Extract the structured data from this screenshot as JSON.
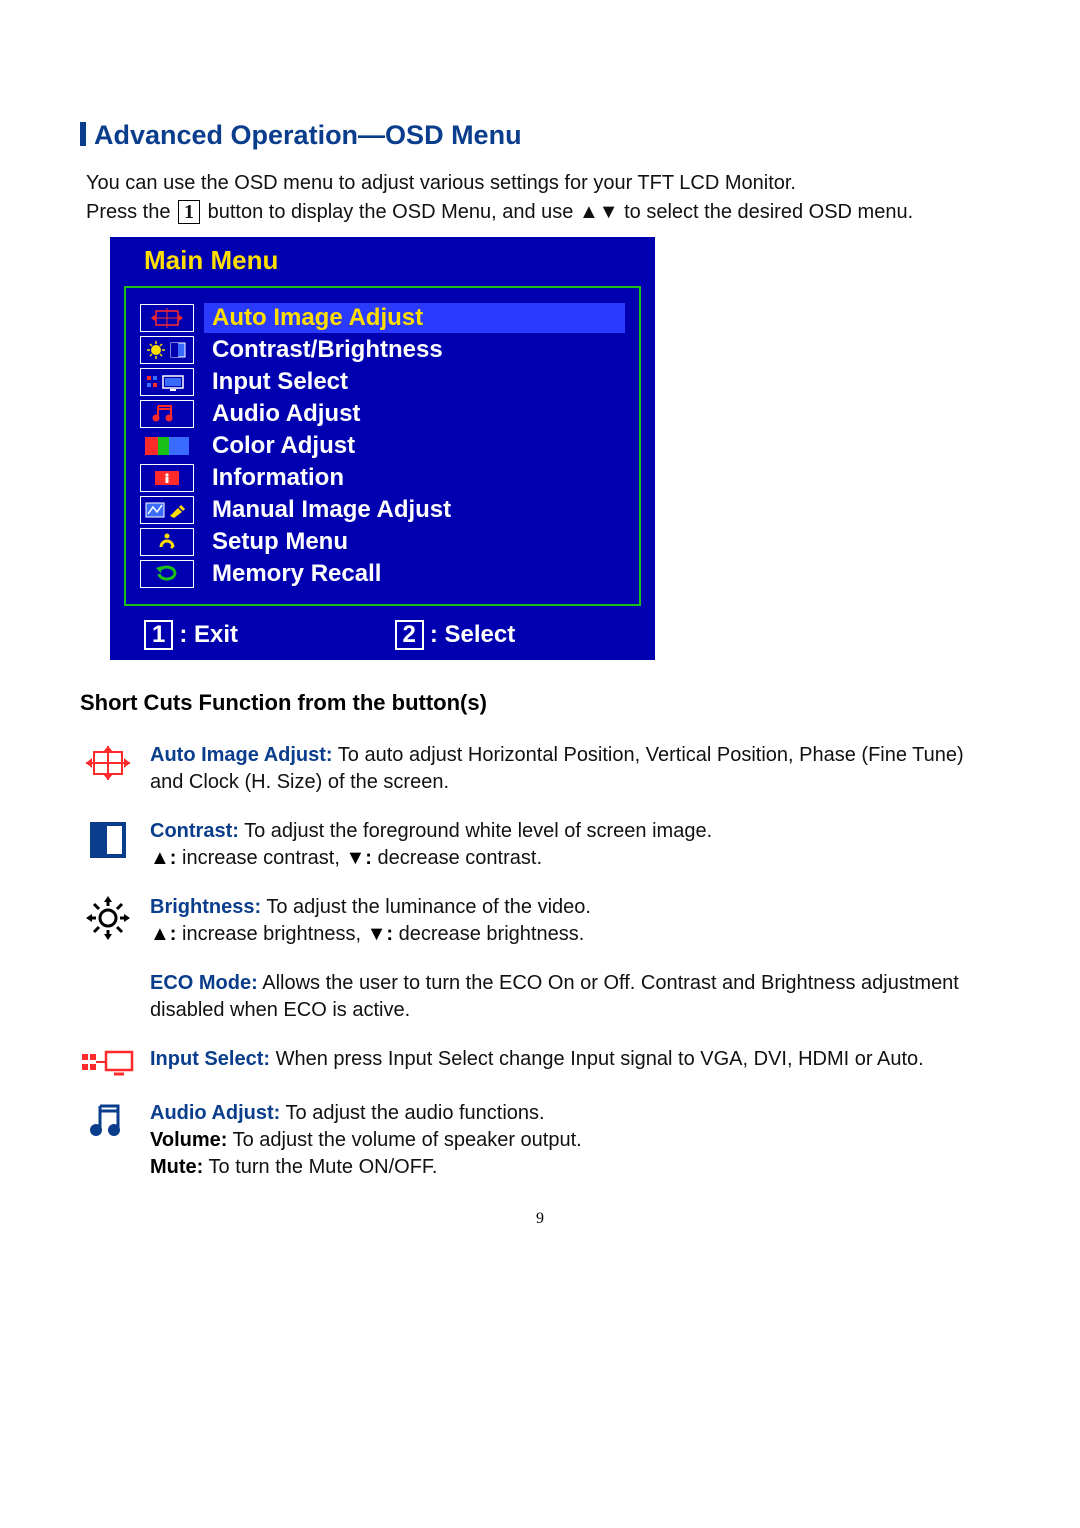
{
  "heading": "Advanced Operation—OSD Menu",
  "intro": {
    "line1": "You can use the OSD menu to adjust various settings for your TFT LCD Monitor.",
    "press_the": "Press the",
    "button_num": "1",
    "after_button": "button to display the OSD Menu, and use ▲▼ to select the desired OSD menu."
  },
  "osd": {
    "title": "Main Menu",
    "items": [
      {
        "label": "Auto Image Adjust",
        "selected": true
      },
      {
        "label": "Contrast/Brightness",
        "selected": false
      },
      {
        "label": "Input Select",
        "selected": false
      },
      {
        "label": "Audio Adjust",
        "selected": false
      },
      {
        "label": "Color Adjust",
        "selected": false
      },
      {
        "label": "Information",
        "selected": false
      },
      {
        "label": "Manual Image Adjust",
        "selected": false
      },
      {
        "label": "Setup Menu",
        "selected": false
      },
      {
        "label": "Memory Recall",
        "selected": false
      }
    ],
    "footer": {
      "exit_num": "1",
      "exit_label": ": Exit",
      "select_num": "2",
      "select_label": ": Select"
    }
  },
  "subheading": "Short Cuts Function from the button(s)",
  "shortcuts": [
    {
      "title": "Auto Image Adjust:",
      "body": " To auto adjust Horizontal Position, Vertical Position, Phase (Fine Tune) and Clock (H. Size) of the screen."
    },
    {
      "title": "Contrast:",
      "body": " To adjust the foreground white level of screen image.",
      "extra1_bold": "▲:",
      "extra1": " increase contrast, ",
      "extra2_bold": "▼:",
      "extra2": " decrease contrast."
    },
    {
      "title": "Brightness:",
      "body": " To adjust the luminance of the video.",
      "extra1_bold": "▲:",
      "extra1": " increase brightness, ",
      "extra2_bold": "▼:",
      "extra2": " decrease brightness."
    },
    {
      "title": "ECO Mode:",
      "body": " Allows the user to turn the ECO On or Off. Contrast and Brightness adjustment disabled when ECO is active."
    },
    {
      "title": "Input Select:",
      "body": " When press Input Select change Input signal to VGA, DVI, HDMI or Auto."
    },
    {
      "title": "Audio Adjust:",
      "body": " To adjust the audio functions.",
      "vol_bold": "Volume:",
      "vol": " To adjust the volume of speaker output.",
      "mute_bold": "Mute:",
      "mute": " To turn the Mute ON/OFF."
    }
  ],
  "page_number": "9"
}
